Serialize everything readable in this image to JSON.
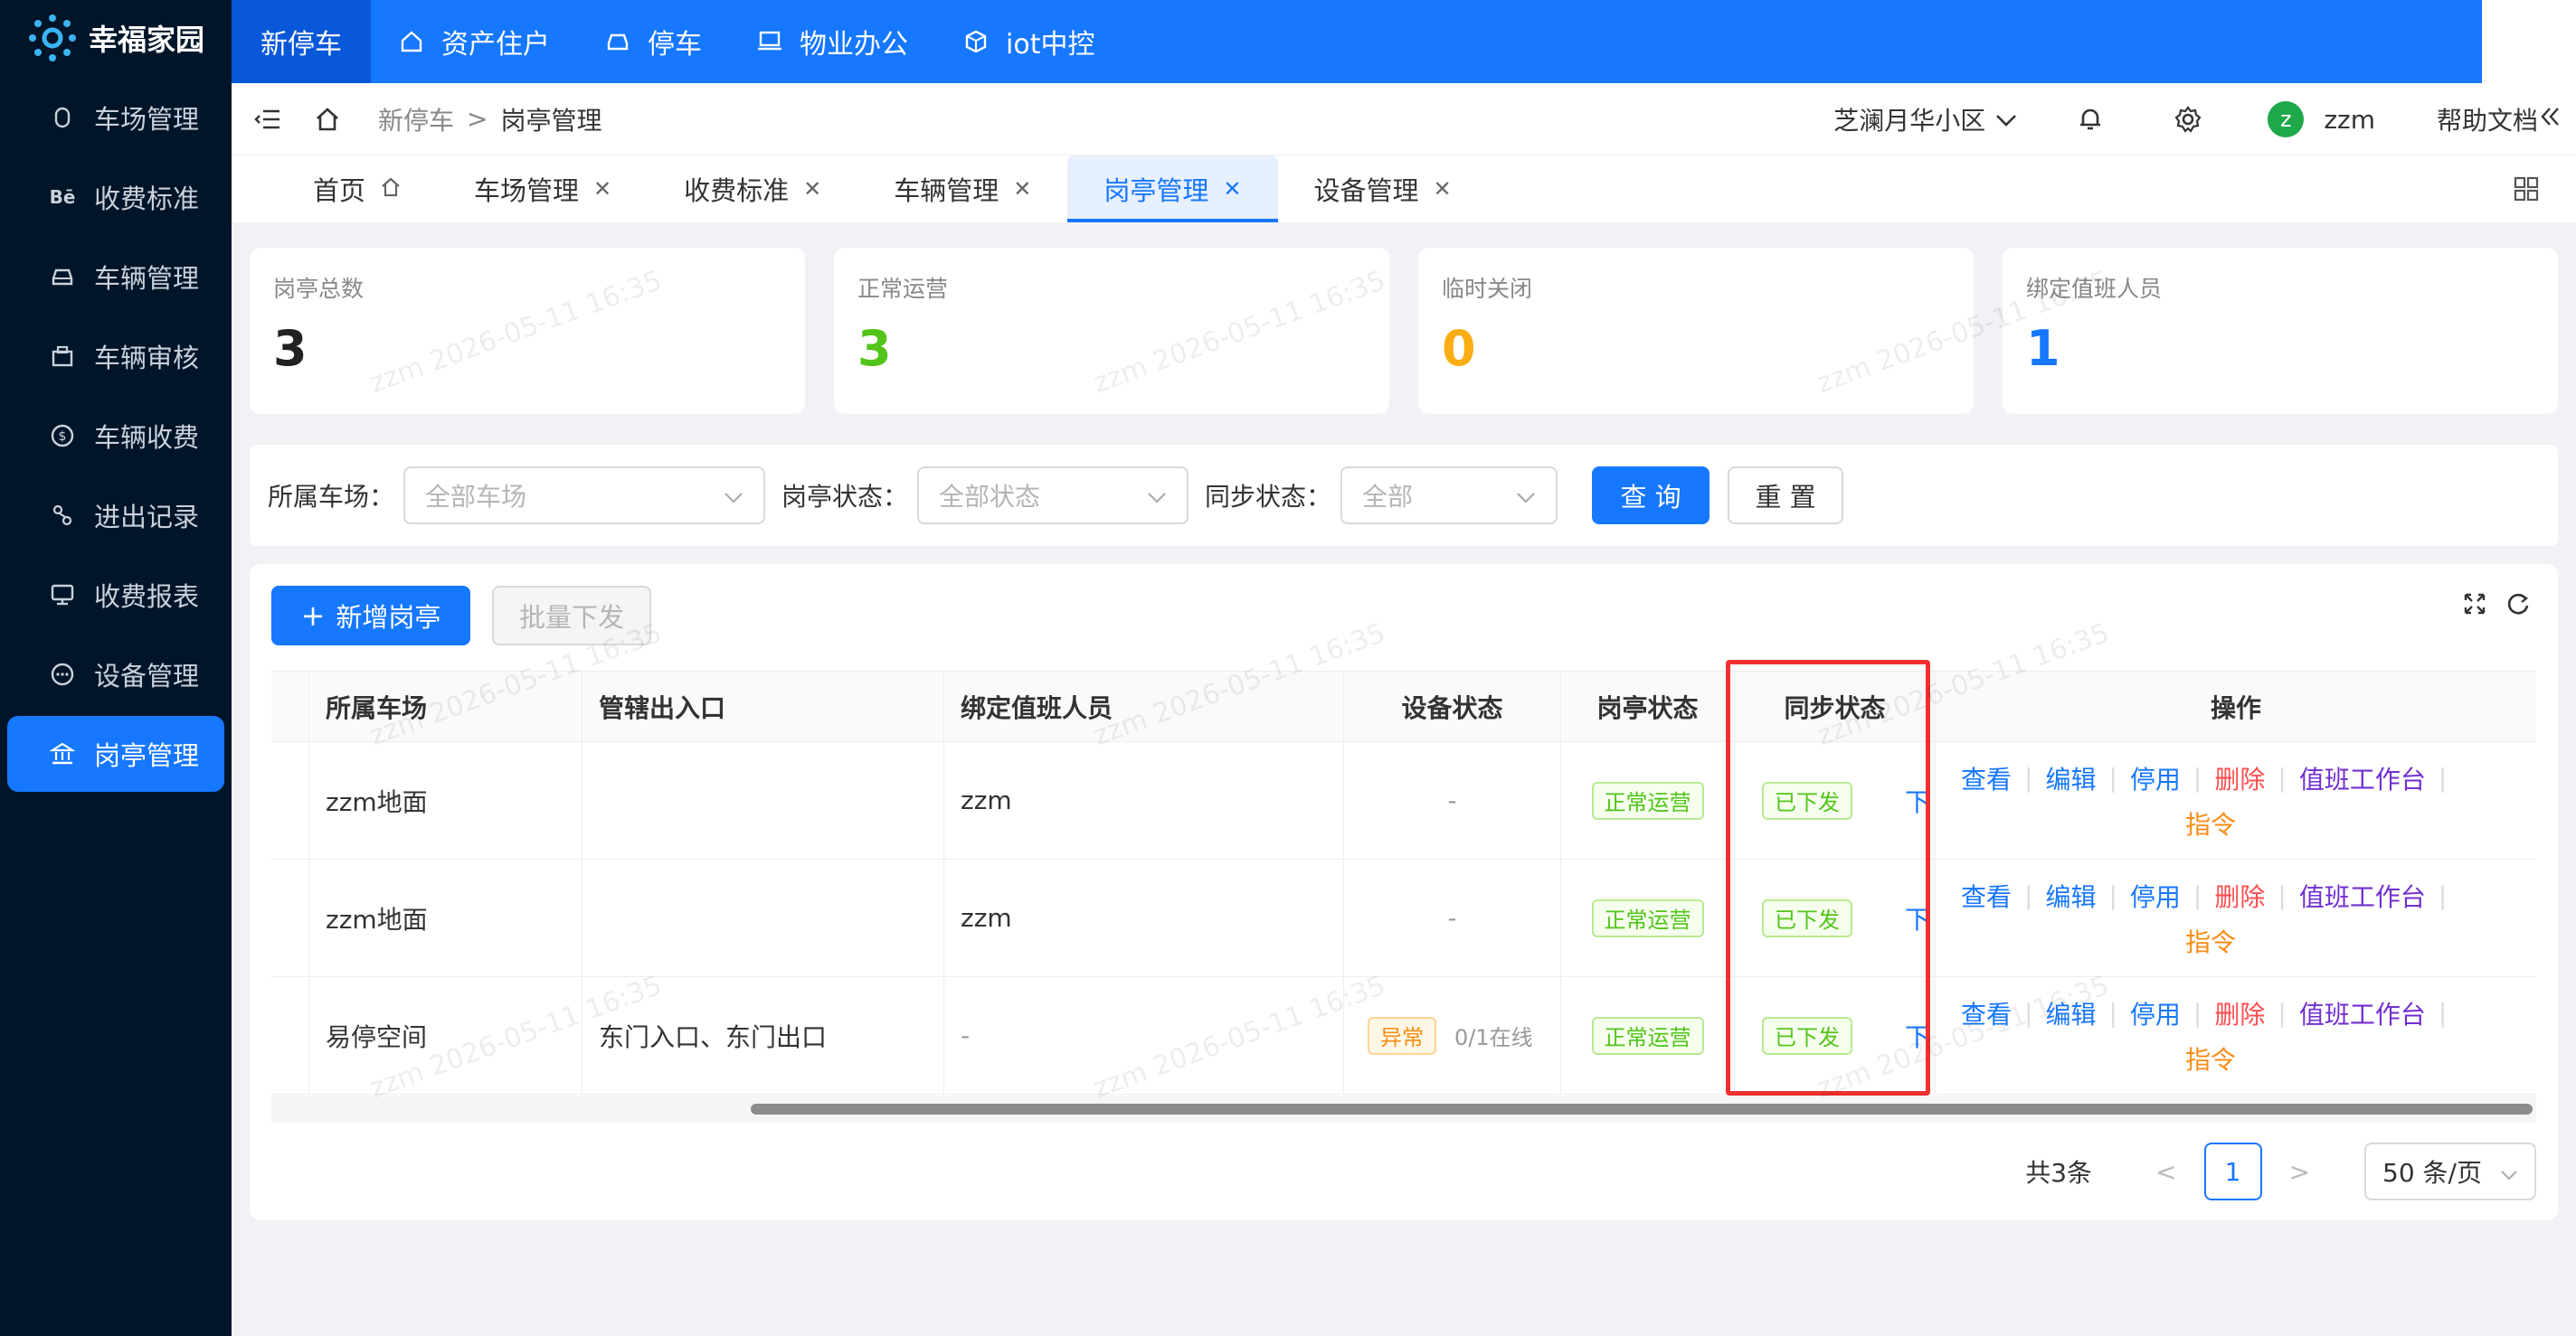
{
  "app": {
    "title": "幸福家园"
  },
  "sidebar": {
    "items": [
      {
        "label": "车场管理",
        "icon": "parking-icon",
        "active": false
      },
      {
        "label": "收费标准",
        "icon": "behance-icon",
        "active": false
      },
      {
        "label": "车辆管理",
        "icon": "car-icon",
        "active": false
      },
      {
        "label": "车辆审核",
        "icon": "building-icon",
        "active": false
      },
      {
        "label": "车辆收费",
        "icon": "dollar-icon",
        "active": false
      },
      {
        "label": "进出记录",
        "icon": "route-icon",
        "active": false
      },
      {
        "label": "收费报表",
        "icon": "report-icon",
        "active": false
      },
      {
        "label": "设备管理",
        "icon": "device-icon",
        "active": false
      },
      {
        "label": "岗亭管理",
        "icon": "bank-icon",
        "active": true
      }
    ]
  },
  "topnav": {
    "items": [
      {
        "label": "新停车",
        "icon": "",
        "active": true
      },
      {
        "label": "资产住户",
        "icon": "home-icon",
        "active": false
      },
      {
        "label": "停车",
        "icon": "car-icon",
        "active": false
      },
      {
        "label": "物业办公",
        "icon": "laptop-icon",
        "active": false
      },
      {
        "label": "iot中控",
        "icon": "cube-icon",
        "active": false
      }
    ]
  },
  "header": {
    "breadcrumb": {
      "parent": "新停车",
      "separator": ">",
      "current": "岗亭管理"
    },
    "community": "芝澜月华小区",
    "user": {
      "avatar_letter": "z",
      "name": "zzm"
    },
    "help": "帮助文档"
  },
  "tabs": [
    {
      "label": "首页",
      "closable": false,
      "home": true,
      "active": false
    },
    {
      "label": "车场管理",
      "closable": true,
      "active": false
    },
    {
      "label": "收费标准",
      "closable": true,
      "active": false
    },
    {
      "label": "车辆管理",
      "closable": true,
      "active": false
    },
    {
      "label": "岗亭管理",
      "closable": true,
      "active": true
    },
    {
      "label": "设备管理",
      "closable": true,
      "active": false
    }
  ],
  "stats": [
    {
      "label": "岗亭总数",
      "value": "3",
      "color": "#222222"
    },
    {
      "label": "正常运营",
      "value": "3",
      "color": "#52c41a"
    },
    {
      "label": "临时关闭",
      "value": "0",
      "color": "#faad14"
    },
    {
      "label": "绑定值班人员",
      "value": "1",
      "color": "#1677ff"
    }
  ],
  "filters": {
    "lot_label": "所属车场：",
    "lot_placeholder": "全部车场",
    "status_label": "岗亭状态：",
    "status_placeholder": "全部状态",
    "sync_label": "同步状态：",
    "sync_placeholder": "全部",
    "query_btn": "查 询",
    "reset_btn": "重 置"
  },
  "toolbar": {
    "add_btn": "新增岗亭",
    "batch_btn": "批量下发"
  },
  "table": {
    "columns": [
      "所属车场",
      "管辖出入口",
      "绑定值班人员",
      "设备状态",
      "岗亭状态",
      "同步状态",
      "操作"
    ],
    "rows": [
      {
        "lot": "zzm地面",
        "gates": "",
        "staff": "zzm",
        "device": "-",
        "device_tag": "",
        "device_online": "",
        "booth_status": "正常运营",
        "sync": "已下发",
        "sync_action": "下"
      },
      {
        "lot": "zzm地面",
        "gates": "",
        "staff": "zzm",
        "device": "-",
        "device_tag": "",
        "device_online": "",
        "booth_status": "正常运营",
        "sync": "已下发",
        "sync_action": "下"
      },
      {
        "lot": "易停空间",
        "gates": "东门入口、东门出口",
        "staff": "-",
        "device": "",
        "device_tag": "异常",
        "device_online": "0/1在线",
        "booth_status": "正常运营",
        "sync": "已下发",
        "sync_action": "下"
      }
    ],
    "actions": {
      "view": "查看",
      "edit": "编辑",
      "disable": "停用",
      "delete": "删除",
      "workbench": "值班工作台",
      "command": "指令",
      "sep": "|"
    }
  },
  "pagination": {
    "total": "共3条",
    "current": "1",
    "page_size": "50 条/页"
  },
  "watermark": "zzm 2026-05-11 16:35",
  "colors": {
    "primary": "#1677ff",
    "sidebar": "#001529",
    "highlight": "#f03030"
  }
}
